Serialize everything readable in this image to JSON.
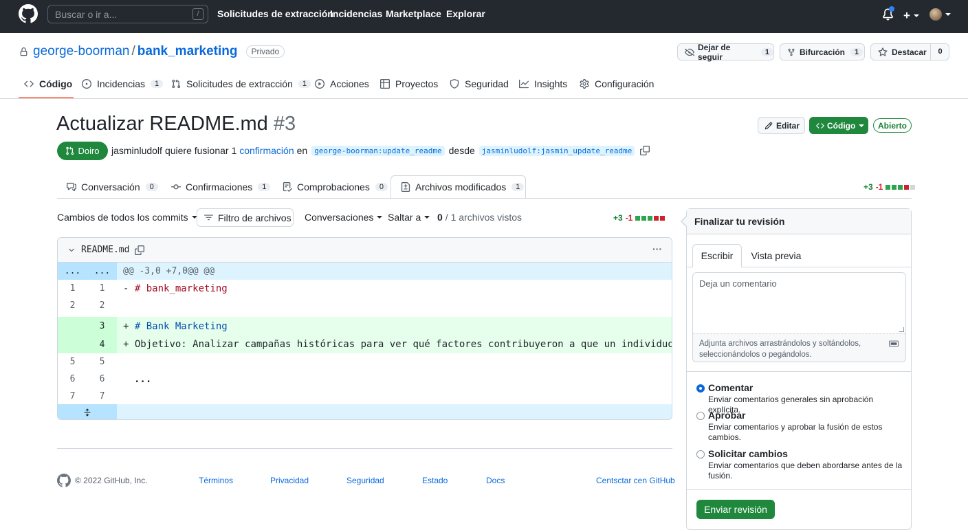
{
  "header": {
    "search_placeholder": "Buscar o ir a...",
    "search_shortcut": "/",
    "nav": [
      "Solicitudes de extracción",
      "Incidencias",
      "Marketplace",
      "Explorar"
    ],
    "plus_label": "+"
  },
  "repo": {
    "owner": "george-boorman",
    "separator": "/",
    "name": "bank_marketing",
    "visibility": "Privado",
    "unwatch_label": "Dejar de seguir",
    "unwatch_count": "1",
    "fork_label": "Bifurcación",
    "fork_count": "1",
    "star_label": "Destacar",
    "star_count": "0"
  },
  "repo_nav": [
    {
      "label": "Código",
      "count": ""
    },
    {
      "label": "Incidencias",
      "count": "1"
    },
    {
      "label": "Solicitudes de extracción",
      "count": "1"
    },
    {
      "label": "Acciones",
      "count": ""
    },
    {
      "label": "Proyectos",
      "count": ""
    },
    {
      "label": "Seguridad",
      "count": ""
    },
    {
      "label": "Insights",
      "count": ""
    },
    {
      "label": "Configuración",
      "count": ""
    }
  ],
  "pr": {
    "title": "Actualizar README.md",
    "number": "#3",
    "edit_label": "Editar",
    "code_label": "Código",
    "status_label": "Abierto",
    "state": "Doiro",
    "author": "jasminludolf",
    "meta_text": "quiere fusionar 1",
    "commit_link": "confirmación",
    "meta_in": "en",
    "base_branch": "george-boorman:update_readme",
    "meta_from": "desde",
    "head_branch": "jasminludolf:jasmin_update_readme"
  },
  "pr_tabs": [
    {
      "label": "Conversación",
      "count": "0"
    },
    {
      "label": "Confirmaciones",
      "count": "1"
    },
    {
      "label": "Comprobaciones",
      "count": "0"
    },
    {
      "label": "Archivos modificados",
      "count": "1"
    }
  ],
  "diffstat": {
    "additions": "+3",
    "deletions": "-1"
  },
  "toolbar": {
    "commits": "Cambios de todos los commits",
    "filter": "Filtro de archivos",
    "conversations": "Conversaciones",
    "jump": "Saltar a",
    "viewed_count": "0",
    "viewed_text": "/ 1 archivos vistos"
  },
  "diff": {
    "filename": "README.md",
    "more": "···",
    "hunk_left": "...",
    "hunk_right": "...",
    "hunk_header": "@@ -3,0 +7,0@@ @@",
    "lines": [
      {
        "old": "1",
        "new": "1",
        "sign": "-",
        "text": "# bank_marketing",
        "type": "ctx-del"
      },
      {
        "old": "2",
        "new": "2",
        "sign": "",
        "text": "",
        "type": "ctx"
      },
      {
        "old": "",
        "new": "3",
        "sign": "+",
        "text": "# Bank Marketing",
        "type": "add"
      },
      {
        "old": "",
        "new": "4",
        "sign": "+",
        "text": "Objetivo: Analizar campañas históricas para ver qué factores contribuyeron a que un individuo…",
        "type": "add"
      },
      {
        "old": "5",
        "new": "5",
        "sign": "",
        "text": "",
        "type": "ctx"
      },
      {
        "old": "6",
        "new": "6",
        "sign": "",
        "text": "...",
        "type": "ctx"
      },
      {
        "old": "7",
        "new": "7",
        "sign": "",
        "text": "",
        "type": "ctx"
      }
    ]
  },
  "review": {
    "title": "Finalizar tu revisión",
    "tab_write": "Escribir",
    "tab_preview": "Vista previa",
    "placeholder": "Deja un comentario",
    "attach_text": "Adjunta archivos arrastrándolos y soltándolos, seleccionándolos o pegándolos.",
    "options": [
      {
        "title": "Comentar",
        "desc": "Enviar comentarios generales sin aprobación explícita.",
        "selected": true
      },
      {
        "title": "Aprobar",
        "desc": "Enviar comentarios y aprobar la fusión de estos cambios.",
        "selected": false
      },
      {
        "title": "Solicitar cambios",
        "desc": "Enviar comentarios que deben abordarse antes de la fusión.",
        "selected": false
      }
    ],
    "submit": "Enviar revisión"
  },
  "footer": {
    "copyright": "© 2022 GitHub, Inc.",
    "links": [
      "Términos",
      "Privacidad",
      "Seguridad",
      "Estado",
      "Docs",
      "Centsctar cen GitHub"
    ]
  },
  "colors": {
    "header_bg": "#24292f",
    "green": "#1f883d",
    "link": "#0969da",
    "add_bg": "#e6ffec",
    "add_num_bg": "#ccffd8",
    "hunk_bg": "#ddf4ff",
    "del_text": "#a40e26"
  }
}
